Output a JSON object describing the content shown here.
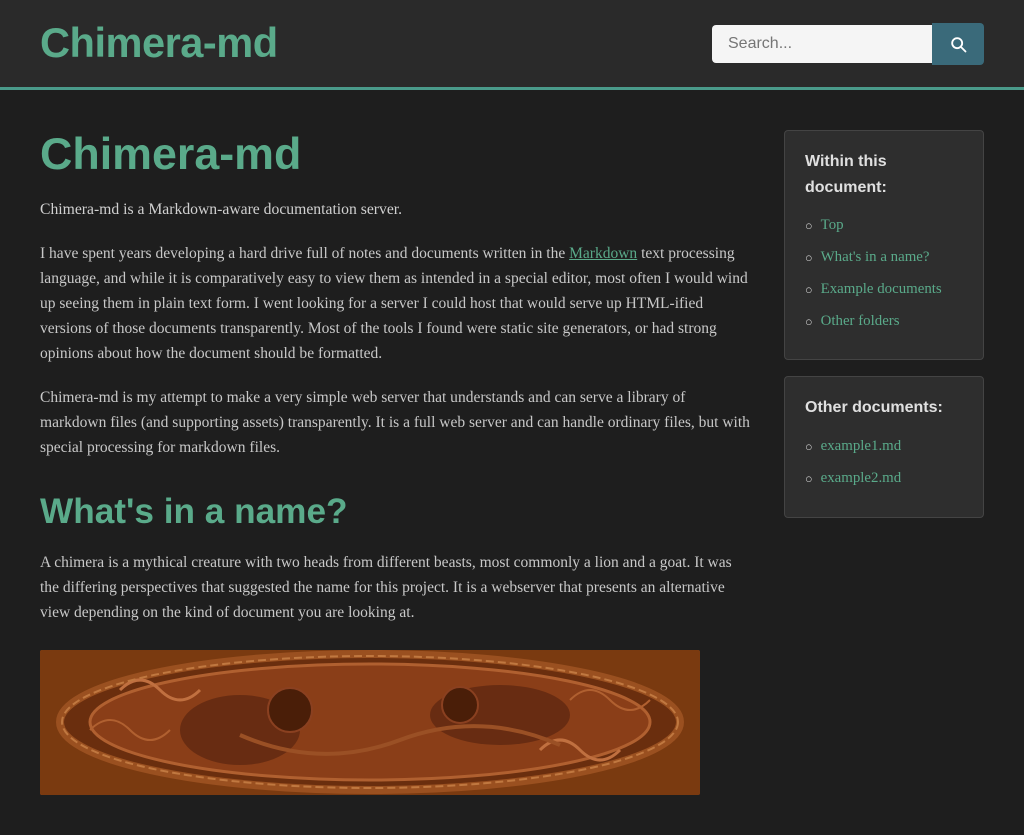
{
  "header": {
    "title": "Chimera-md",
    "search": {
      "placeholder": "Search...",
      "button_label": "Search"
    }
  },
  "main": {
    "page_title": "Chimera-md",
    "intro": "Chimera-md is a Markdown-aware documentation server.",
    "body1_before_link": "I have spent years developing a hard drive full of notes and documents written in the ",
    "body1_link_text": "Markdown",
    "body1_after_link": " text processing language, and while it is comparatively easy to view them as intended in a special editor, most often I would wind up seeing them in plain text form. I went looking for a server I could host that would serve up HTML-ified versions of those documents transparently. Most of the tools I found were static site generators, or had strong opinions about how the document should be formatted.",
    "body2": "Chimera-md is my attempt to make a very simple web server that understands and can serve a library of markdown files (and supporting assets) transparently. It is a full web server and can handle ordinary files, but with special processing for markdown files.",
    "section_heading": "What's in a name?",
    "section_text": "A chimera is a mythical creature with two heads from different beasts, most commonly a lion and a goat. It was the differing perspectives that suggested the name for this project. It is a webserver that presents an alternative view depending on the kind of document you are looking at.",
    "image_alt": "Chimera pottery image"
  },
  "sidebar": {
    "within_title": "Within this document:",
    "within_items": [
      {
        "label": "Top",
        "href": "#top"
      },
      {
        "label": "What's in a name?",
        "href": "#name"
      },
      {
        "label": "Example documents",
        "href": "#examples"
      },
      {
        "label": "Other folders",
        "href": "#folders"
      }
    ],
    "other_title": "Other documents:",
    "other_items": [
      {
        "label": "example1.md",
        "href": "#example1"
      },
      {
        "label": "example2.md",
        "href": "#example2"
      }
    ]
  }
}
